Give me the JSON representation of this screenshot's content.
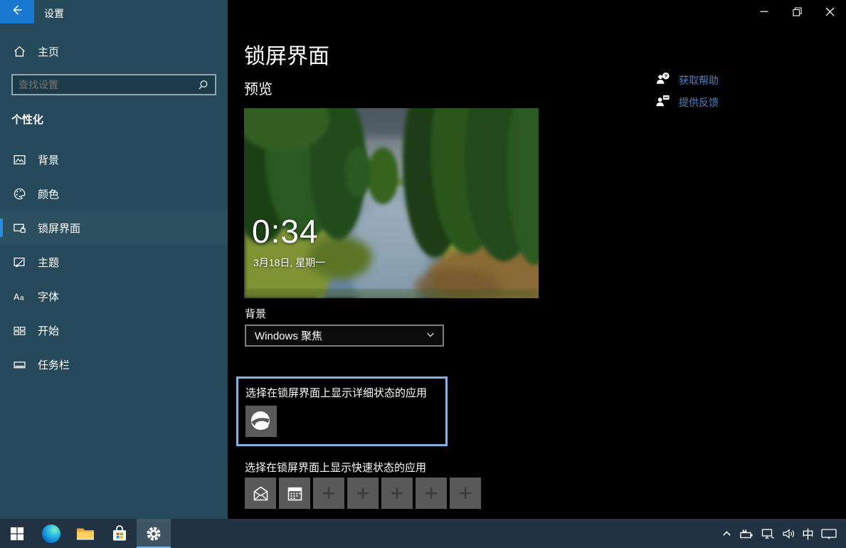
{
  "colors": {
    "accent": "#1979d0",
    "sidebar_bg": "#25495a",
    "content_bg": "#000000",
    "taskbar_bg": "#213343",
    "link_blue": "#4580c0",
    "highlight_border": "#80b2e2",
    "tile_gray": "#595959"
  },
  "titlebar": {
    "title": "设置",
    "back_icon": "arrow-left-icon",
    "controls": [
      "minimize",
      "restore",
      "close"
    ]
  },
  "sidebar": {
    "home_label": "主页",
    "search": {
      "placeholder": "查找设置",
      "icon": "search-icon"
    },
    "section_title": "个性化",
    "items": [
      {
        "label": "背景",
        "icon": "background-image-icon",
        "active": false
      },
      {
        "label": "颜色",
        "icon": "colors-palette-icon",
        "active": false
      },
      {
        "label": "锁屏界面",
        "icon": "lock-screen-icon",
        "active": true
      },
      {
        "label": "主题",
        "icon": "themes-icon",
        "active": false
      },
      {
        "label": "字体",
        "icon": "fonts-icon",
        "active": false
      },
      {
        "label": "开始",
        "icon": "start-layout-icon",
        "active": false
      },
      {
        "label": "任务栏",
        "icon": "taskbar-rect-icon",
        "active": false
      }
    ]
  },
  "main": {
    "page_title": "锁屏界面",
    "preview_label": "预览",
    "preview": {
      "time": "0:34",
      "date": "3月18日, 星期一"
    },
    "background": {
      "label": "背景",
      "selected_option": "Windows 聚焦"
    },
    "detailed_status": {
      "label": "选择在锁屏界面上显示详细状态的应用",
      "apps": [
        {
          "icon": "weather-app-icon"
        }
      ]
    },
    "quick_status": {
      "label": "选择在锁屏界面上显示快速状态的应用",
      "apps": [
        {
          "icon": "mail-app-icon"
        },
        {
          "icon": "calendar-app-icon"
        }
      ],
      "empty_slots": 5
    }
  },
  "help": {
    "get_help": "获取帮助",
    "send_feedback": "提供反馈"
  },
  "taskbar": {
    "buttons": [
      "start",
      "edge",
      "file-explorer",
      "store",
      "settings"
    ],
    "active_button": "settings",
    "tray": {
      "ime_label": "中"
    }
  }
}
